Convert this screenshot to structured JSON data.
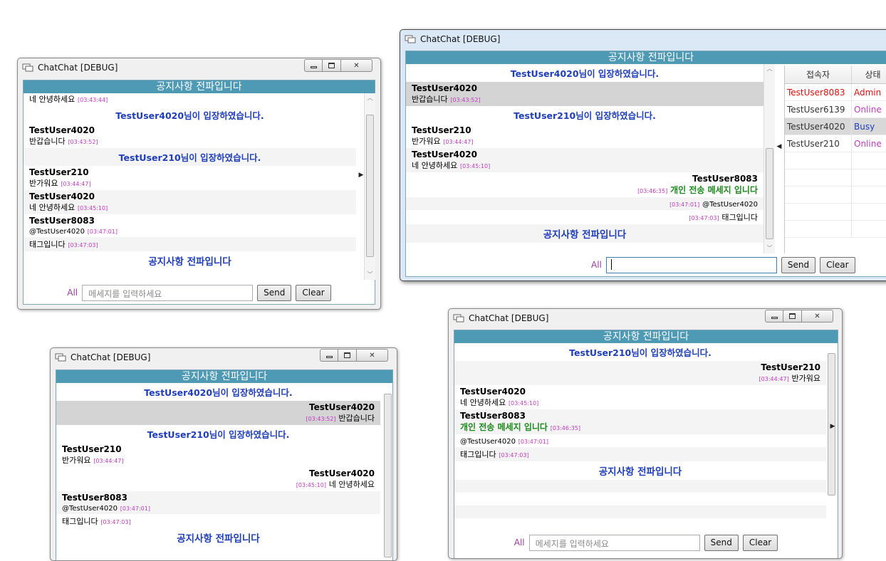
{
  "app": {
    "title": "ChatChat [DEBUG]",
    "notice": "공지사항 전파입니다"
  },
  "colors": {
    "notice_bar": "#4e9ab5",
    "system_text": "#1f3fb8",
    "timestamp": "#c23ac2",
    "whisper": "#1e8a1e",
    "admin": "#e01010",
    "online": "#c23ac2",
    "busy": "#1f3fb8"
  },
  "icons": [
    "chat-icon",
    "minimize-icon",
    "maximize-icon",
    "close-icon",
    "scroll-up-icon",
    "scroll-down-icon",
    "expand-right-icon",
    "collapse-left-icon"
  ],
  "composer": {
    "target": "All",
    "placeholder": "메세지를 입력하세요",
    "send": "Send",
    "clear": "Clear"
  },
  "win1": {
    "partial_message": "네 안녕하세요",
    "partial_time": "[03:43:44]",
    "join1": "TestUser4020님이 입장하였습니다.",
    "m1": {
      "name": "TestUser4020",
      "text": "반갑습니다",
      "time": "[03:43:52]"
    },
    "join2": "TestUser210님이 입장하였습니다.",
    "m2": {
      "name": "TestUser210",
      "text": "반가워요",
      "time": "[03:44:47]"
    },
    "m3": {
      "name": "TestUser4020",
      "text": "네 안녕하세요",
      "time": "[03:45:10]"
    },
    "m4": {
      "name": "TestUser8083",
      "text": "@TestUser4020",
      "time": "[03:47:01]"
    },
    "m5": {
      "text": "태그입니다",
      "time": "[03:47:03]"
    },
    "notice": "공지사항 전파입니다"
  },
  "win2": {
    "join1": "TestUser4020님이 입장하였습니다.",
    "m1": {
      "name": "TestUser4020",
      "text": "반갑습니다",
      "time": "[03:43:52]"
    },
    "join2": "TestUser210님이 입장하였습니다.",
    "m2": {
      "name": "TestUser210",
      "text": "반가워요",
      "time": "[03:44:47]"
    },
    "m3": {
      "name": "TestUser4020",
      "text": "네 안녕하세요",
      "time": "[03:45:10]"
    },
    "m4": {
      "name": "TestUser8083",
      "text": "개인 전송 메세지 입니다",
      "time": "[03:46:35]"
    },
    "m5": {
      "text": "@TestUser4020",
      "time": "[03:47:01]"
    },
    "m6": {
      "text": "태그입니다",
      "time": "[03:47:03]"
    },
    "notice": "공지사항 전파입니다",
    "users_header": {
      "name": "접속자",
      "status": "상태"
    },
    "users": [
      {
        "name": "TestUser8083",
        "status": "Admin"
      },
      {
        "name": "TestUser6139",
        "status": "Online"
      },
      {
        "name": "TestUser4020",
        "status": "Busy"
      },
      {
        "name": "TestUser210",
        "status": "Online"
      }
    ]
  },
  "win3": {
    "join1": "TestUser4020님이 입장하였습니다.",
    "m1": {
      "name": "TestUser4020",
      "text": "반갑습니다",
      "time": "[03:43:52]"
    },
    "join2": "TestUser210님이 입장하였습니다.",
    "m2": {
      "name": "TestUser210",
      "text": "반가워요",
      "time": "[03:44:47]"
    },
    "m3": {
      "name": "TestUser4020",
      "text": "네 안녕하세요",
      "time": "[03:45:10]"
    },
    "m4": {
      "name": "TestUser8083",
      "text": "@TestUser4020",
      "time": "[03:47:01]"
    },
    "m5": {
      "text": "태그입니다",
      "time": "[03:47:03]"
    },
    "notice": "공지사항 전파입니다"
  },
  "win4": {
    "join1": "TestUser210님이 입장하였습니다.",
    "m1": {
      "name": "TestUser210",
      "text": "반가워요",
      "time": "[03:44:47]"
    },
    "m2": {
      "name": "TestUser4020",
      "text": "네 안녕하세요",
      "time": "[03:45:10]"
    },
    "m3": {
      "name": "TestUser8083",
      "text": "개인 전송 메세지 입니다",
      "time": "[03:46:35]"
    },
    "m4": {
      "text": "@TestUser4020",
      "time": "[03:47:01]"
    },
    "m5": {
      "text": "태그입니다",
      "time": "[03:47:03]"
    },
    "notice": "공지사항 전파입니다"
  }
}
